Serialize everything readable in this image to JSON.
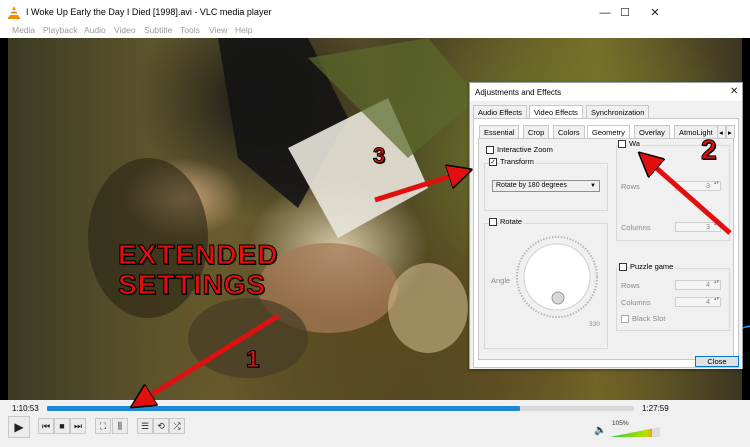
{
  "window": {
    "title": "I Woke Up Early the Day I Died [1998].avi - VLC media player",
    "minimize_icon": "—",
    "maximize_icon": "☐",
    "close_icon": "✕"
  },
  "menu": {
    "items": [
      "Media",
      "Playback",
      "Audio",
      "Video",
      "Subtitle",
      "Tools",
      "View",
      "Help"
    ]
  },
  "player": {
    "time_elapsed": "1:10:53",
    "time_total": "1:27:59",
    "progress": 0.805,
    "volume_label": "105%",
    "volume": 1.05
  },
  "dialog": {
    "title": "Adjustments and Effects",
    "close_x": "✕",
    "main_tabs": [
      "Audio Effects",
      "Video Effects",
      "Synchronization"
    ],
    "active_main_tab": "Video Effects",
    "sub_tabs": [
      "Essential",
      "Crop",
      "Colors",
      "Geometry",
      "Overlay",
      "AtmoLight"
    ],
    "active_sub_tab": "Geometry",
    "interactive_zoom": "Interactive Zoom",
    "transform": "Transform",
    "transform_checked": true,
    "transform_select": "Rotate by 180 degrees",
    "rotate": "Rotate",
    "angle": "Angle",
    "dial_value": "330",
    "wall": "Wa",
    "rows": "Rows",
    "rows_value": "3",
    "columns": "Columns",
    "columns_value": "3",
    "puzzle": "Puzzle game",
    "puzzle_rows": "Rows",
    "puzzle_rows_value": "4",
    "puzzle_columns": "Columns",
    "puzzle_columns_value": "4",
    "black_slot": "Black Slot",
    "close_button": "Close"
  },
  "annotations": {
    "extended_line1": "EXTENDED",
    "extended_line2": "SETTINGS",
    "step1": "1",
    "step2": "2",
    "step3": "3",
    "arrow_color": "#e01010"
  }
}
